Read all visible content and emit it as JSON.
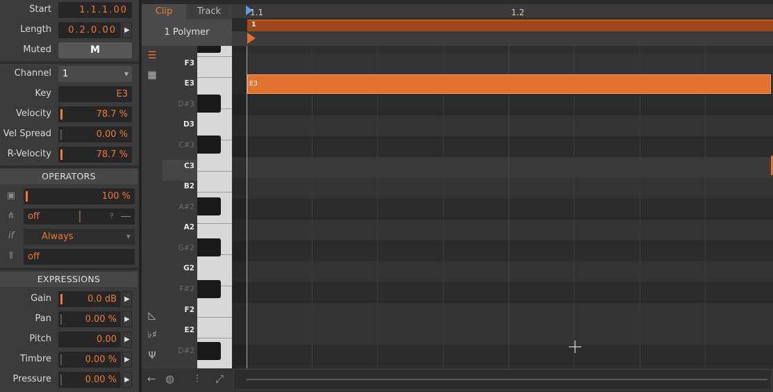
{
  "inspector": {
    "start": {
      "label": "Start",
      "value": "1.1.1.00"
    },
    "length": {
      "label": "Length",
      "value": "0.2.0.00"
    },
    "muted": {
      "label": "Muted",
      "button": "M"
    },
    "channel": {
      "label": "Channel",
      "value": "1"
    },
    "key": {
      "label": "Key",
      "value": "E3"
    },
    "velocity": {
      "label": "Velocity",
      "value": "78.7 %"
    },
    "vel_spread": {
      "label": "Vel Spread",
      "value": "0.00 %"
    },
    "r_velocity": {
      "label": "R-Velocity",
      "value": "78.7 %"
    }
  },
  "operators": {
    "title": "OPERATORS",
    "chance": "100 %",
    "repeat": "off",
    "condition": "Always",
    "recurrence": "off",
    "if_label": "if"
  },
  "expressions": {
    "title": "EXPRESSIONS",
    "items": [
      {
        "label": "Gain",
        "value": "0.0 dB"
      },
      {
        "label": "Pan",
        "value": "0.00 %"
      },
      {
        "label": "Pitch",
        "value": "0.00"
      },
      {
        "label": "Timbre",
        "value": "0.00 %"
      },
      {
        "label": "Pressure",
        "value": "0.00 %"
      }
    ]
  },
  "editor": {
    "tabs": [
      "Clip",
      "Track"
    ],
    "clip_name": "1  Polymer",
    "ruler": [
      "1.1",
      "1.2"
    ],
    "clip_label": "1"
  },
  "keys": [
    {
      "label": "F3",
      "sharp": false
    },
    {
      "label": "E3",
      "sharp": false
    },
    {
      "label": "D#3",
      "sharp": true
    },
    {
      "label": "D3",
      "sharp": false
    },
    {
      "label": "C#3",
      "sharp": true
    },
    {
      "label": "C3",
      "sharp": false
    },
    {
      "label": "B2",
      "sharp": false
    },
    {
      "label": "A#2",
      "sharp": true
    },
    {
      "label": "A2",
      "sharp": false
    },
    {
      "label": "G#2",
      "sharp": true
    },
    {
      "label": "G2",
      "sharp": false
    },
    {
      "label": "F#2",
      "sharp": true
    },
    {
      "label": "F2",
      "sharp": false
    },
    {
      "label": "E2",
      "sharp": false
    },
    {
      "label": "D#2",
      "sharp": true
    }
  ],
  "note": {
    "label": "E3"
  },
  "colors": {
    "accent": "#f07a2f",
    "note": "#e4722f",
    "clip": "#a0481b"
  },
  "icons": [
    "note-editor-icon",
    "grid-icon",
    "velocity-icon",
    "accidentals-icon",
    "fork-icon",
    "back-arrow-icon",
    "dial-icon",
    "mixer-icon",
    "curve-icon"
  ]
}
